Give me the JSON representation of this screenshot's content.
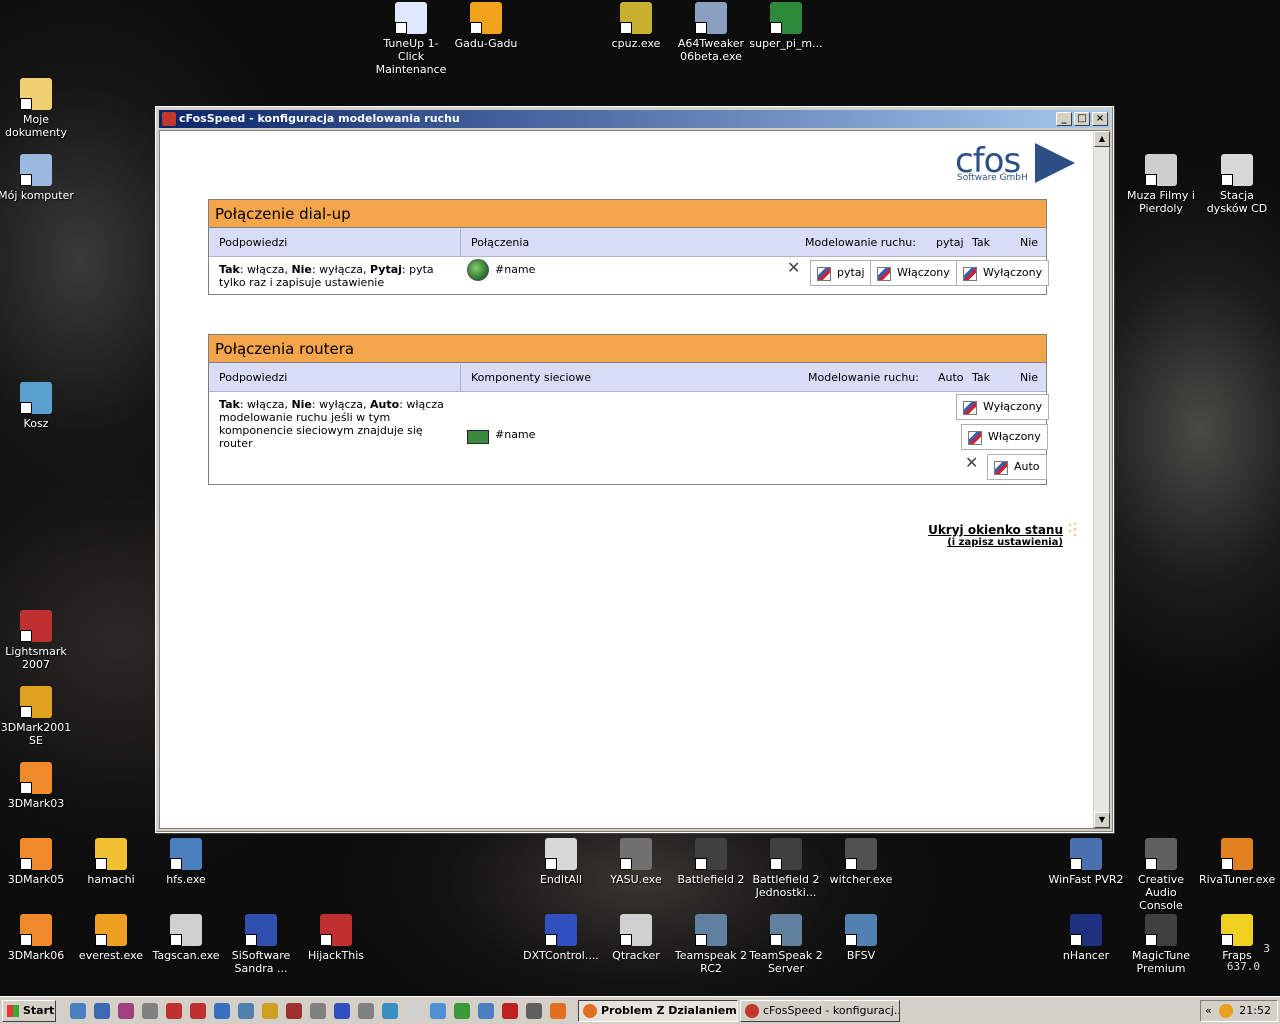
{
  "desktop": {
    "icons": [
      {
        "label": "TuneUp 1-Click Maintenance",
        "icon": "tuneup-icon",
        "color": "#dfe8ff"
      },
      {
        "label": "Gadu-Gadu",
        "icon": "sun-icon",
        "color": "#f2a21b"
      },
      {
        "label": "cpuz.exe",
        "icon": "cpuz-icon",
        "color": "#c8b030"
      },
      {
        "label": "A64Tweaker 06beta.exe",
        "icon": "tweaker-icon",
        "color": "#8aa0c0"
      },
      {
        "label": "super_pi_m...",
        "icon": "superpi-icon",
        "color": "#2d8a3a"
      },
      {
        "label": "Moje dokumenty",
        "icon": "folder-icon",
        "color": "#f0d070"
      },
      {
        "label": "Mój komputer",
        "icon": "computer-icon",
        "color": "#9ab8e0"
      },
      {
        "label": "Muza Filmy i Pierdoly",
        "icon": "drive-icon",
        "color": "#cfcfcf"
      },
      {
        "label": "Stacja dysków CD",
        "icon": "cd-drive-icon",
        "color": "#d8d8d8"
      },
      {
        "label": "Kosz",
        "icon": "recycle-bin-icon",
        "color": "#5aa0d0"
      },
      {
        "label": "Lightsmark 2007",
        "icon": "lightsmark-icon",
        "color": "#c03030"
      },
      {
        "label": "3DMark2001 SE",
        "icon": "3dmark-icon",
        "color": "#e0a020"
      },
      {
        "label": "3DMark03",
        "icon": "futuremark-icon",
        "color": "#f08a2a"
      },
      {
        "label": "3DMark05",
        "icon": "futuremark-icon",
        "color": "#f08a2a"
      },
      {
        "label": "hamachi",
        "icon": "hamachi-icon",
        "color": "#f0c030"
      },
      {
        "label": "hfs.exe",
        "icon": "globe-icon",
        "color": "#4a80c0"
      },
      {
        "label": "EndItAll",
        "icon": "skull-icon",
        "color": "#d8d8d8"
      },
      {
        "label": "YASU.exe",
        "icon": "yasu-icon",
        "color": "#707070"
      },
      {
        "label": "Battlefield 2",
        "icon": "battlefield-icon",
        "color": "#404040"
      },
      {
        "label": "Battlefield 2 Jednostki...",
        "icon": "battlefield-icon",
        "color": "#404040"
      },
      {
        "label": "witcher.exe",
        "icon": "witcher-icon",
        "color": "#505050"
      },
      {
        "label": "WinFast PVR2",
        "icon": "pvr-icon",
        "color": "#4a70b0"
      },
      {
        "label": "Creative Audio Console",
        "icon": "audio-icon",
        "color": "#606060"
      },
      {
        "label": "RivaTuner.exe",
        "icon": "rivatuner-icon",
        "color": "#e08020"
      },
      {
        "label": "3DMark06",
        "icon": "futuremark-icon",
        "color": "#f08a2a"
      },
      {
        "label": "everest.exe",
        "icon": "everest-icon",
        "color": "#f0a020"
      },
      {
        "label": "Tagscan.exe",
        "icon": "magnifier-icon",
        "color": "#d0d0d0"
      },
      {
        "label": "SiSoftware Sandra ...",
        "icon": "sandra-icon",
        "color": "#3050b0"
      },
      {
        "label": "HijackThis",
        "icon": "hijackthis-icon",
        "color": "#c03030"
      },
      {
        "label": "DXTControl....",
        "icon": "dxt-icon",
        "color": "#3050c0"
      },
      {
        "label": "Qtracker",
        "icon": "qtracker-icon",
        "color": "#d0d0d0"
      },
      {
        "label": "Teamspeak 2 RC2",
        "icon": "teamspeak-icon",
        "color": "#6080a0"
      },
      {
        "label": "TeamSpeak 2 Server",
        "icon": "teamspeak-icon",
        "color": "#6080a0"
      },
      {
        "label": "BFSV",
        "icon": "bfsv-icon",
        "color": "#5080b0"
      },
      {
        "label": "nHancer",
        "icon": "nhancer-icon",
        "color": "#203080"
      },
      {
        "label": "MagicTune Premium",
        "icon": "magictune-icon",
        "color": "#404040"
      },
      {
        "label": "Fraps",
        "icon": "fraps-icon",
        "color": "#f0d020"
      }
    ]
  },
  "window": {
    "title": "cFosSpeed - konfiguracja modelowania ruchu",
    "controls": {
      "minimize": "_",
      "maximize": "□",
      "close": "×"
    },
    "logo": {
      "main": "cfos",
      "sub": "Software GmbH"
    }
  },
  "dialup": {
    "title": "Połączenie dial-up",
    "col_hints": "Podpowiedzi",
    "col_connections": "Połączenia",
    "col_shaping": "Modelowanie ruchu:",
    "opt_ask": "pytaj",
    "opt_yes": "Tak",
    "opt_no": "Nie",
    "hint_bold1": "Tak",
    "hint_t1": ": włącza, ",
    "hint_bold2": "Nie",
    "hint_t2": ": wyłącza, ",
    "hint_bold3": "Pytaj",
    "hint_t3": ": pyta tylko raz i zapisuje ustawienie",
    "connection_name": "#name",
    "btn_ask": "pytaj",
    "btn_on": "Włączony",
    "btn_off": "Wyłączony"
  },
  "router": {
    "title": "Połączenia routera",
    "col_hints": "Podpowiedzi",
    "col_components": "Komponenty sieciowe",
    "col_shaping": "Modelowanie ruchu:",
    "opt_auto": "Auto",
    "opt_yes": "Tak",
    "opt_no": "Nie",
    "hint_bold1": "Tak",
    "hint_t1": ": włącza, ",
    "hint_bold2": "Nie",
    "hint_t2": ": wyłącza, ",
    "hint_bold3": "Auto",
    "hint_t3": ": włącza modelowanie ruchu jeśli w tym komponencie sieciowym znajduje się router",
    "component_name": "#name",
    "btn_off": "Wyłączony",
    "btn_on": "Włączony",
    "btn_auto": "Auto"
  },
  "hide_link": {
    "line1": "Ukryj okienko stanu",
    "line2": "(i zapisz ustawienia)"
  },
  "taskbar": {
    "start": "Start",
    "tasks": [
      {
        "label": "Problem Z Dzialaniem...",
        "active": true
      },
      {
        "label": "cFosSpeed - konfiguracj...",
        "active": false
      }
    ],
    "tray_chevron": "«",
    "clock": "21:52"
  },
  "monitor_overlay": {
    "value": "637.0",
    "index": "3"
  }
}
